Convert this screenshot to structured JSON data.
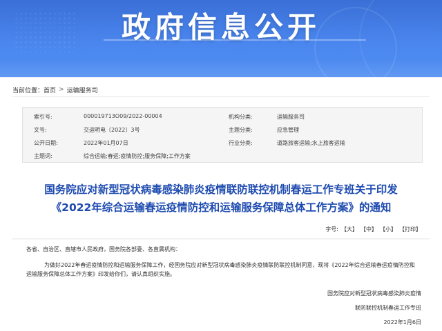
{
  "banner": {
    "title": "政府信息公开"
  },
  "breadcrumb": {
    "prefix": "当前位置：",
    "home": "首页",
    "separator": ">",
    "current": "运输服务司"
  },
  "info": {
    "rows": [
      {
        "k1": "索引号:",
        "v1": "000019713O09/2022-00004",
        "k2": "机构分类:",
        "v2": "运输服务司"
      },
      {
        "k1": "文号:",
        "v1": "交运明电〔2022〕3号",
        "k2": "主题分类:",
        "v2": "应急管理"
      },
      {
        "k1": "公开日期:",
        "v1": "2022年01月07日",
        "k2": "行业分类:",
        "v2": "道路旅客运输;水上旅客运输"
      },
      {
        "k1": "主题词:",
        "v1": "综合运输;春运;疫情防控;服务保障;工作方案",
        "k2": "",
        "v2": ""
      }
    ]
  },
  "article": {
    "title_line1": "国务院应对新型冠状病毒感染肺炎疫情联防联控机制春运工作专班关于印发",
    "title_line2": "《2022年综合运输春运疫情防控和运输服务保障总体工作方案》的通知"
  },
  "fontsize": {
    "label": "字号:",
    "large": "【大】",
    "medium": "【中】",
    "small": "【小】",
    "print": "【打印】"
  },
  "body": {
    "salutation": "各省、自治区、直辖市人民政府，国务院各部委、各直属机构：",
    "paragraph": "为做好2022年春运疫情防控和运输服务保障工作，经国务院应对新型冠状病毒感染肺炎疫情联防联控机制同意，现将《2022年综合运输春运疫情防控和运输服务保障总体工作方案》印发给你们，请认真组织实施。",
    "signature_line1": "国务院应对新型冠状病毒感染肺炎疫情",
    "signature_line2": "联防联控机制春运工作专班",
    "date": "2022年1月6日"
  }
}
